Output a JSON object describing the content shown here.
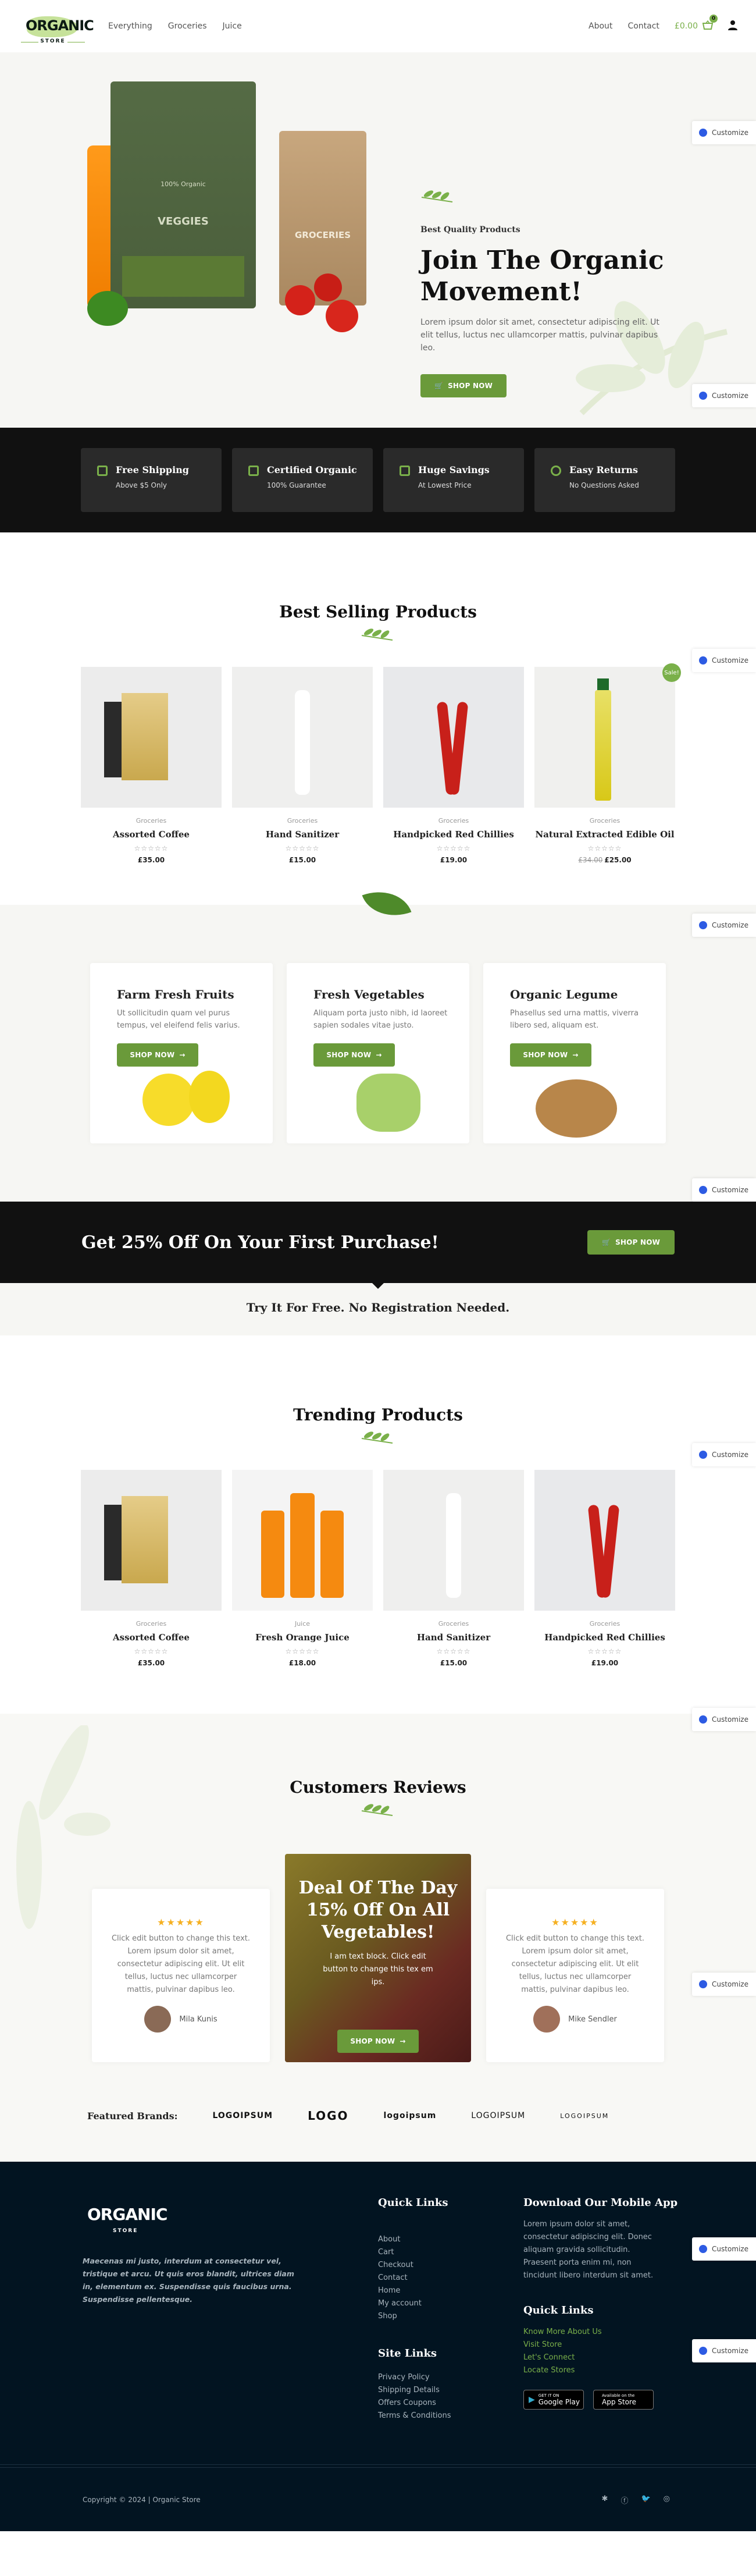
{
  "header": {
    "logo_text": "ORGANIC",
    "logo_sub": "STORE",
    "nav_left": [
      "Everything",
      "Groceries",
      "Juice"
    ],
    "nav_right": [
      "About",
      "Contact"
    ],
    "cart_total": "£0.00",
    "cart_count": "0"
  },
  "customize_label": "Customize",
  "hero": {
    "eyebrow": "Best Quality Products",
    "title": "Join The Organic Movement!",
    "body": "Lorem ipsum dolor sit amet, consectetur adipiscing elit. Ut elit tellus, luctus nec ullamcorper mattis, pulvinar dapibus leo.",
    "cta": "SHOP NOW",
    "bag1_label": "VEGGIES",
    "bag2_label": "GROCERIES",
    "bag_badge": "100% Organic"
  },
  "features": [
    {
      "icon": "truck-icon",
      "title": "Free Shipping",
      "sub": "Above $5 Only"
    },
    {
      "icon": "certificate-icon",
      "title": "Certified Organic",
      "sub": "100% Guarantee"
    },
    {
      "icon": "money-icon",
      "title": "Huge Savings",
      "sub": "At Lowest Price"
    },
    {
      "icon": "recycle-icon",
      "title": "Easy Returns",
      "sub": "No Questions Asked"
    }
  ],
  "best_selling": {
    "title": "Best Selling Products",
    "products": [
      {
        "category": "Groceries",
        "name": "Assorted Coffee",
        "price": "£35.00",
        "old_price": null,
        "sale": null,
        "rating": 0
      },
      {
        "category": "Groceries",
        "name": "Hand Sanitizer",
        "price": "£15.00",
        "old_price": null,
        "sale": null,
        "rating": 0
      },
      {
        "category": "Groceries",
        "name": "Handpicked Red Chillies",
        "price": "£19.00",
        "old_price": null,
        "sale": null,
        "rating": 0
      },
      {
        "category": "Groceries",
        "name": "Natural Extracted Edible Oil",
        "price": "£25.00",
        "old_price": "£34.00",
        "sale": "Sale!",
        "rating": 0
      }
    ]
  },
  "categories": [
    {
      "title": "Farm Fresh Fruits",
      "body": "Ut sollicitudin quam vel purus tempus, vel eleifend felis varius.",
      "cta": "SHOP NOW"
    },
    {
      "title": "Fresh Vegetables",
      "body": "Aliquam porta justo nibh, id laoreet sapien sodales vitae justo.",
      "cta": "SHOP NOW"
    },
    {
      "title": "Organic Legume",
      "body": "Phasellus sed urna mattis, viverra libero sed, aliquam est.",
      "cta": "SHOP NOW"
    }
  ],
  "promo": {
    "title": "Get 25% Off On Your First Purchase!",
    "cta": "SHOP NOW",
    "subtitle": "Try It For Free. No Registration Needed."
  },
  "trending": {
    "title": "Trending Products",
    "products": [
      {
        "category": "Groceries",
        "name": "Assorted Coffee",
        "price": "£35.00"
      },
      {
        "category": "Juice",
        "name": "Fresh Orange Juice",
        "price": "£18.00"
      },
      {
        "category": "Groceries",
        "name": "Hand Sanitizer",
        "price": "£15.00"
      },
      {
        "category": "Groceries",
        "name": "Handpicked Red Chillies",
        "price": "£19.00"
      }
    ]
  },
  "reviews": {
    "title": "Customers Reviews",
    "items": [
      {
        "stars": "★★★★★",
        "text": "Click edit button to change this text. Lorem ipsum dolor sit amet, consectetur adipiscing elit. Ut elit tellus, luctus nec ullamcorper mattis, pulvinar dapibus leo.",
        "name": "Mila Kunis"
      },
      {
        "stars": "★★★★★",
        "text": "Click edit button to change this text. Lorem ipsum dolor sit amet, consectetur adipiscing elit. Ut elit tellus, luctus nec ullamcorper mattis, pulvinar dapibus leo.",
        "name": "Mike Sendler"
      }
    ],
    "deal": {
      "title": "Deal Of The Day 15% Off On All Vegetables!",
      "body": "I am text block. Click edit button to change this tex em ips.",
      "cta": "SHOP NOW"
    }
  },
  "brands": {
    "label": "Featured Brands:",
    "items": [
      "LOGOIPSUM",
      "LOGO",
      "logoipsum",
      "LOGOIPSUM",
      "LOGOIPSUM"
    ]
  },
  "footer": {
    "about": "Maecenas mi justo, interdum at consectetur vel, tristique et arcu. Ut quis eros blandit, ultrices diam in, elementum ex. Suspendisse quis faucibus urna. Suspendisse pellentesque.",
    "quick_links_title": "Quick Links",
    "quick_links": [
      "About",
      "Cart",
      "Checkout",
      "Contact",
      "Home",
      "My account",
      "Shop"
    ],
    "site_links_title": "Site Links",
    "site_links": [
      "Privacy Policy",
      "Shipping Details",
      "Offers Coupons",
      "Terms & Conditions"
    ],
    "app_title": "Download Our Mobile App",
    "app_body": "Lorem ipsum dolor sit amet, consectetur adipiscing elit. Donec aliquam gravida sollicitudin. Praesent porta enim mi, non tincidunt libero interdum sit amet.",
    "quick_links2_title": "Quick Links",
    "quick_links2": [
      "Know More About Us",
      "Visit Store",
      "Let's Connect",
      "Locate Stores"
    ],
    "google_play_small": "GET IT ON",
    "google_play": "Google Play",
    "app_store_small": "Available on the",
    "app_store": "App Store",
    "copyright": "Copyright © 2024 | Organic Store",
    "social": [
      "yelp-icon",
      "facebook-icon",
      "twitter-icon",
      "instagram-icon"
    ]
  },
  "colors": {
    "accent": "#6a9a3a",
    "accent_light": "#7ab04a",
    "dark": "#111111",
    "footer_bg": "#021421"
  }
}
